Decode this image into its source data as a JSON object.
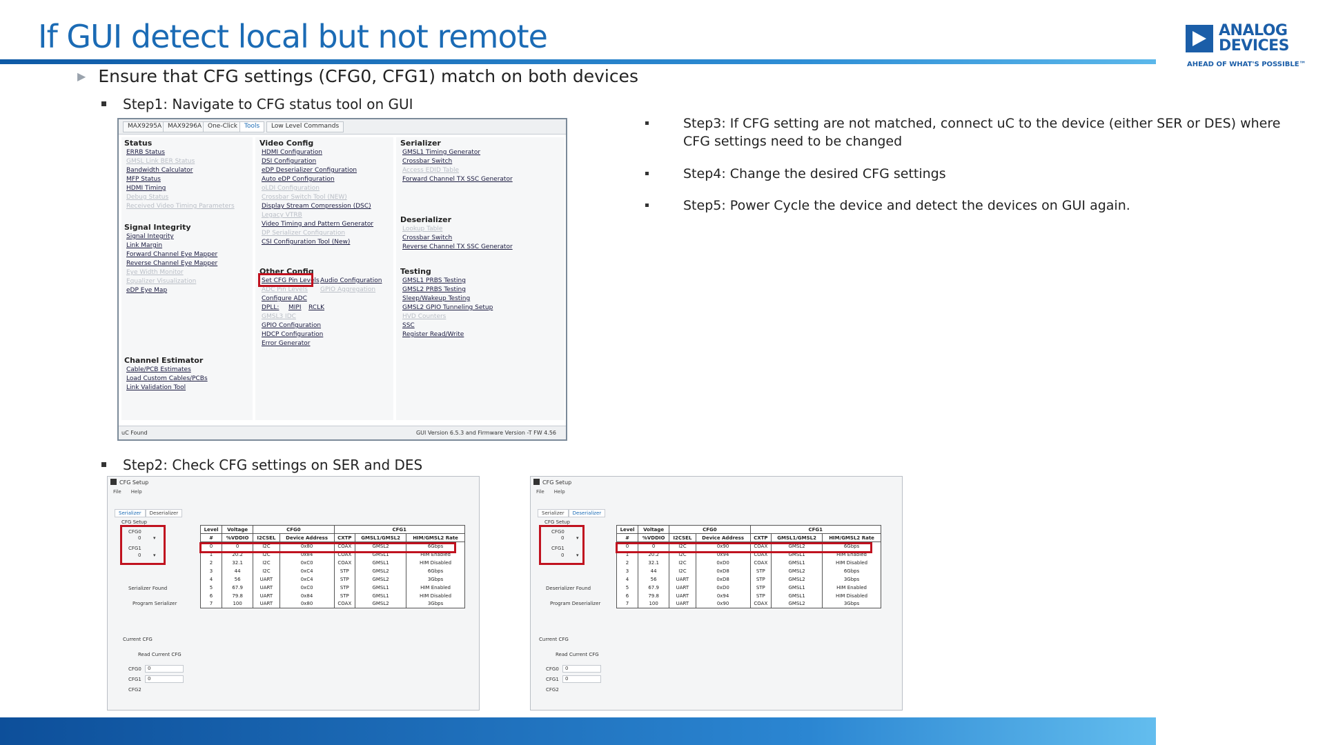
{
  "slide": {
    "title": "If GUI detect local but not remote",
    "bullet1": "Ensure that CFG settings (CFG0, CFG1) match on both devices",
    "step1": "Step1: Navigate to CFG status tool on GUI",
    "step2": "Step2: Check CFG settings on SER and DES",
    "step3": "Step3: If CFG setting are not matched, connect uC to the device (either SER or DES) where CFG settings need to be changed",
    "step4": "Step4: Change the desired CFG settings",
    "step5": "Step5: Power Cycle the device and detect the devices on GUI again."
  },
  "logo": {
    "line1": "ANALOG",
    "line2": "DEVICES",
    "tagline": "AHEAD OF WHAT'S POSSIBLE™"
  },
  "gui": {
    "tabs": [
      "MAX9295A",
      "MAX9296A",
      "One-Click",
      "Tools",
      "Low Level Commands"
    ],
    "status": {
      "header": "Status",
      "links": [
        "ERRB Status",
        "GMSL Link BER Status",
        "Bandwidth Calculator",
        "MFP Status",
        "HDMI Timing",
        "Debug Status",
        "Received Video Timing Parameters"
      ]
    },
    "signal": {
      "header": "Signal Integrity",
      "links": [
        "Signal Integrity",
        "Link Margin",
        "Forward Channel Eye Mapper",
        "Reverse Channel Eye Mapper",
        "Eye Width Monitor",
        "Equalizer Visualization",
        "eDP Eye Map"
      ]
    },
    "channel": {
      "header": "Channel Estimator",
      "links": [
        "Cable/PCB Estimates",
        "Load Custom Cables/PCBs",
        "Link Validation Tool"
      ]
    },
    "video": {
      "header": "Video Config",
      "links": [
        "HDMI Configuration",
        "DSI Configuration",
        "eDP Deserializer Configuration",
        "Auto eDP Configuration",
        "oLDI Configuration",
        "Crossbar Switch Tool (NEW)",
        "Display Stream Compression (DSC)",
        "Legacy VTRB",
        "Video Timing and Pattern Generator",
        "DP Serializer Configuration",
        "CSI Configuration Tool (New)"
      ]
    },
    "other": {
      "header": "Other Config",
      "links": [
        "Set CFG Pin Levels",
        "Audio Configuration",
        "ADC Pin Levels",
        "GPIO Aggregation",
        "Configure ADC",
        "DPLL:",
        "MIPI",
        "RCLK",
        "GMSL3 IDC",
        "GPIO Configuration",
        "HDCP Configuration",
        "Error Generator"
      ]
    },
    "serializer": {
      "header": "Serializer",
      "links": [
        "GMSL1 Timing Generator",
        "Crossbar Switch",
        "Access EDID Table",
        "Forward Channel TX SSC Generator"
      ]
    },
    "deserializer": {
      "header": "Deserializer",
      "links": [
        "Lookup Table",
        "Crossbar Switch",
        "Reverse Channel TX SSC Generator"
      ]
    },
    "testing": {
      "header": "Testing",
      "links": [
        "GMSL1 PRBS Testing",
        "GMSL2 PRBS Testing",
        "Sleep/Wakeup Testing",
        "GMSL2 GPIO Tunneling Setup",
        "HVD Counters",
        "SSC",
        "Register Read/Write"
      ]
    },
    "statusbar": {
      "left": "uC Found",
      "right": "GUI Version 6.5.3 and Firmware Version -T FW 4.56"
    }
  },
  "cfg_common": {
    "window_title": "CFG Setup",
    "menu": [
      "File",
      "Help"
    ],
    "tabs": [
      "Serializer",
      "Deserializer"
    ],
    "group_label": "CFG Setup",
    "cfg0_label": "CFG0",
    "cfg1_label": "CFG1",
    "cfg_value": "0",
    "current_label": "Current CFG",
    "read_button": "Read Current CFG",
    "cur_cfg0": "CFG0",
    "cur_cfg1": "CFG1",
    "cur_cfg2": "CFG2",
    "cur_value": "0",
    "header1": [
      "Level",
      "Voltage",
      "CFG0",
      "CFG1"
    ],
    "header2": [
      "#",
      "%VDDIO",
      "I2CSEL",
      "Device Address",
      "CXTP",
      "GMSL1/GMSL2",
      "HIM/GMSL2 Rate"
    ]
  },
  "cfg_ser": {
    "found": "Serializer Found",
    "program": "Program Serializer",
    "rows": [
      [
        "0",
        "0",
        "I2C",
        "0x80",
        "COAX",
        "GMSL2",
        "6Gbps"
      ],
      [
        "1",
        "20.2",
        "I2C",
        "0x84",
        "COAX",
        "GMSL1",
        "HIM Enabled"
      ],
      [
        "2",
        "32.1",
        "I2C",
        "0xC0",
        "COAX",
        "GMSL1",
        "HIM Disabled"
      ],
      [
        "3",
        "44",
        "I2C",
        "0xC4",
        "STP",
        "GMSL2",
        "6Gbps"
      ],
      [
        "4",
        "56",
        "UART",
        "0xC4",
        "STP",
        "GMSL2",
        "3Gbps"
      ],
      [
        "5",
        "67.9",
        "UART",
        "0xC0",
        "STP",
        "GMSL1",
        "HIM Enabled"
      ],
      [
        "6",
        "79.8",
        "UART",
        "0x84",
        "STP",
        "GMSL1",
        "HIM Disabled"
      ],
      [
        "7",
        "100",
        "UART",
        "0x80",
        "COAX",
        "GMSL2",
        "3Gbps"
      ]
    ]
  },
  "cfg_des": {
    "found": "Deserializer Found",
    "program": "Program Deserializer",
    "rows": [
      [
        "0",
        "0",
        "I2C",
        "0x90",
        "COAX",
        "GMSL2",
        "6Gbps"
      ],
      [
        "1",
        "20.2",
        "I2C",
        "0x94",
        "COAX",
        "GMSL1",
        "HIM Enabled"
      ],
      [
        "2",
        "32.1",
        "I2C",
        "0xD0",
        "COAX",
        "GMSL1",
        "HIM Disabled"
      ],
      [
        "3",
        "44",
        "I2C",
        "0xD8",
        "STP",
        "GMSL2",
        "6Gbps"
      ],
      [
        "4",
        "56",
        "UART",
        "0xD8",
        "STP",
        "GMSL2",
        "3Gbps"
      ],
      [
        "5",
        "67.9",
        "UART",
        "0xD0",
        "STP",
        "GMSL1",
        "HIM Enabled"
      ],
      [
        "6",
        "79.8",
        "UART",
        "0x94",
        "STP",
        "GMSL1",
        "HIM Disabled"
      ],
      [
        "7",
        "100",
        "UART",
        "0x90",
        "COAX",
        "GMSL2",
        "3Gbps"
      ]
    ]
  },
  "colors": {
    "title": "#1b6bb5",
    "accent_red": "#c0121f",
    "bar": "#2b86d2"
  }
}
